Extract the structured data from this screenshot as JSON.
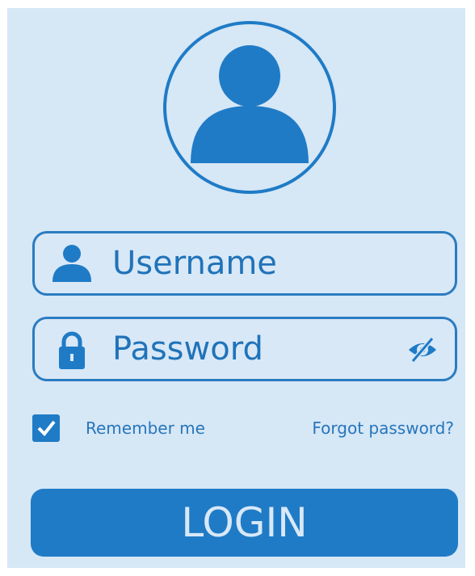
{
  "colors": {
    "background": "#d6e7f6",
    "accent": "#1f7bc6",
    "text": "#2073b9",
    "button_text": "#d8e8f7"
  },
  "icons": {
    "avatar": "user-avatar-icon",
    "username": "user-icon",
    "password": "lock-icon",
    "visibility": "eye-off-icon",
    "checkbox": "checkmark-icon"
  },
  "form": {
    "username": {
      "placeholder": "Username",
      "value": ""
    },
    "password": {
      "placeholder": "Password",
      "value": ""
    },
    "remember_me": {
      "label": "Remember me",
      "checked": true
    },
    "forgot_password": "Forgot password?",
    "login_label": "LOGIN"
  }
}
